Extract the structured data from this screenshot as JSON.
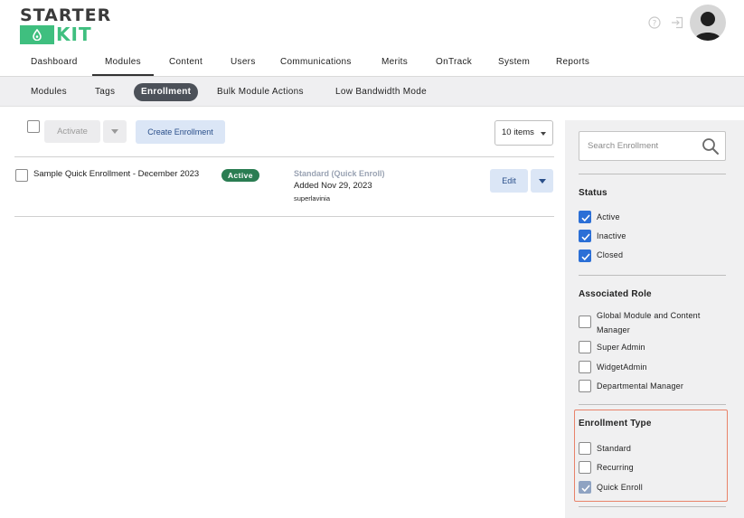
{
  "header": {
    "logo": {
      "top": "STARTER",
      "bottom": "KIT"
    },
    "icons": [
      "help-icon",
      "sign-out-icon"
    ],
    "avatar": "user-avatar"
  },
  "main_nav": {
    "items": [
      "Dashboard",
      "Modules",
      "Content",
      "Users",
      "Communications",
      "Merits",
      "OnTrack",
      "System",
      "Reports"
    ],
    "active": "Modules"
  },
  "sub_nav": {
    "items": [
      "Modules",
      "Tags",
      "Enrollment",
      "Bulk Module Actions",
      "Low Bandwidth Mode"
    ],
    "active": "Enrollment"
  },
  "toolbar": {
    "activate_label": "Activate",
    "create_label": "Create Enrollment",
    "items_per_page": "10 items"
  },
  "enrollments": [
    {
      "title": "Sample Quick Enrollment - December 2023",
      "status": "Active",
      "type": "Standard (Quick Enroll)",
      "added": "Added Nov 29, 2023",
      "user": "superlavinia",
      "edit_label": "Edit"
    }
  ],
  "filters": {
    "search_placeholder": "Search Enrollment",
    "status": {
      "title": "Status",
      "options": [
        {
          "label": "Active",
          "checked": true
        },
        {
          "label": "Inactive",
          "checked": true
        },
        {
          "label": "Closed",
          "checked": true
        }
      ]
    },
    "role": {
      "title": "Associated Role",
      "options": [
        {
          "label_line1": "Global Module and Content",
          "label_line2": "Manager",
          "checked": false
        },
        {
          "label": "Super Admin",
          "checked": false
        },
        {
          "label": "WidgetAdmin",
          "checked": false
        },
        {
          "label": "Departmental Manager",
          "checked": false
        }
      ]
    },
    "enrollment_type": {
      "title": "Enrollment Type",
      "options": [
        {
          "label": "Standard",
          "checked": false
        },
        {
          "label": "Recurring",
          "checked": false
        },
        {
          "label": "Quick Enroll",
          "checked": true
        }
      ]
    }
  },
  "colors": {
    "brand_green": "#3fbf7f",
    "active_badge": "#2a7d52",
    "checkbox_blue": "#2b6fd6",
    "highlight_border": "#e8826a"
  }
}
